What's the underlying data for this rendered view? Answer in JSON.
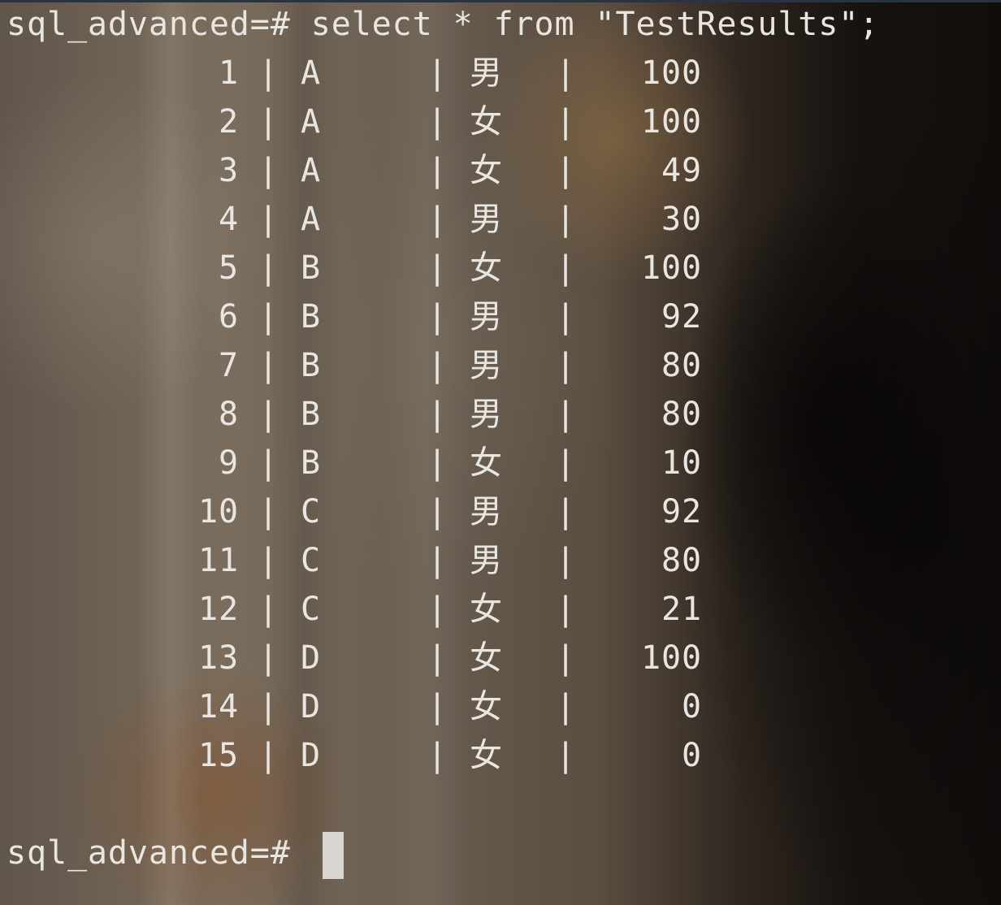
{
  "terminal": {
    "command_line": "sql_advanced=# select * from \"TestResults\";",
    "prompt": "sql_advanced=#",
    "separator": "|",
    "rows": [
      {
        "id": "1",
        "group": "A",
        "sex": "男",
        "score": "100"
      },
      {
        "id": "2",
        "group": "A",
        "sex": "女",
        "score": "100"
      },
      {
        "id": "3",
        "group": "A",
        "sex": "女",
        "score": "49"
      },
      {
        "id": "4",
        "group": "A",
        "sex": "男",
        "score": "30"
      },
      {
        "id": "5",
        "group": "B",
        "sex": "女",
        "score": "100"
      },
      {
        "id": "6",
        "group": "B",
        "sex": "男",
        "score": "92"
      },
      {
        "id": "7",
        "group": "B",
        "sex": "男",
        "score": "80"
      },
      {
        "id": "8",
        "group": "B",
        "sex": "男",
        "score": "80"
      },
      {
        "id": "9",
        "group": "B",
        "sex": "女",
        "score": "10"
      },
      {
        "id": "10",
        "group": "C",
        "sex": "男",
        "score": "92"
      },
      {
        "id": "11",
        "group": "C",
        "sex": "男",
        "score": "80"
      },
      {
        "id": "12",
        "group": "C",
        "sex": "女",
        "score": "21"
      },
      {
        "id": "13",
        "group": "D",
        "sex": "女",
        "score": "100"
      },
      {
        "id": "14",
        "group": "D",
        "sex": "女",
        "score": "0"
      },
      {
        "id": "15",
        "group": "D",
        "sex": "女",
        "score": "0"
      }
    ]
  }
}
